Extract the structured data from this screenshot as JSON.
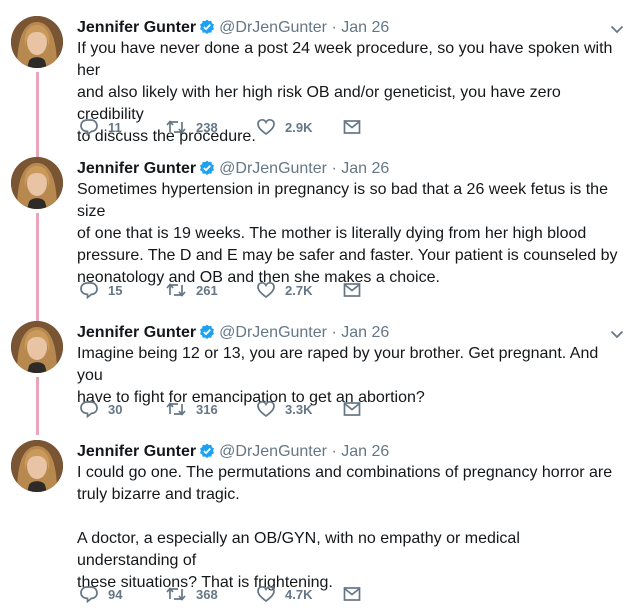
{
  "tweets": [
    {
      "name": "Jennifer Gunter",
      "handle": "@DrJenGunter",
      "separator": "·",
      "date": "Jan 26",
      "text": "If you have never done a post 24 week procedure, so you have spoken with her\nand also likely with her high risk OB and/or geneticist, you have zero credibility\nto discuss the procedure.",
      "replies": "11",
      "retweets": "238",
      "likes": "2.9K"
    },
    {
      "name": "Jennifer Gunter",
      "handle": "@DrJenGunter",
      "separator": "·",
      "date": "Jan 26",
      "text": "Sometimes hypertension in pregnancy is so bad that a 26 week fetus is the size\nof one that is 19 weeks. The mother is literally dying from her high blood\npressure. The D and E may be safer and faster. Your patient is counseled by\nneonatology and OB and then she makes a choice.",
      "replies": "15",
      "retweets": "261",
      "likes": "2.7K"
    },
    {
      "name": "Jennifer Gunter",
      "handle": "@DrJenGunter",
      "separator": "·",
      "date": "Jan 26",
      "text": "Imagine being 12 or 13, you are raped by your brother. Get pregnant. And you\nhave to fight for emancipation to get an abortion?",
      "replies": "30",
      "retweets": "316",
      "likes": "3.3K"
    },
    {
      "name": "Jennifer Gunter",
      "handle": "@DrJenGunter",
      "separator": "·",
      "date": "Jan 26",
      "text": "I could go one. The permutations and combinations of pregnancy horror are\ntruly bizarre and tragic.\n\nA doctor, a especially an OB/GYN, with no empathy or medical understanding of\nthese situations? That is frightening.",
      "replies": "94",
      "retweets": "368",
      "likes": "4.7K"
    }
  ],
  "icons": {
    "verified": "verified-badge-icon",
    "caret": "chevron-down-icon",
    "reply": "reply-icon",
    "retweet": "retweet-icon",
    "like": "heart-icon",
    "dm": "envelope-icon"
  },
  "colors": {
    "thread_line": "#e9a6bb",
    "verified": "#1da1f2",
    "secondary_text": "#657786",
    "primary_text": "#14171a"
  }
}
